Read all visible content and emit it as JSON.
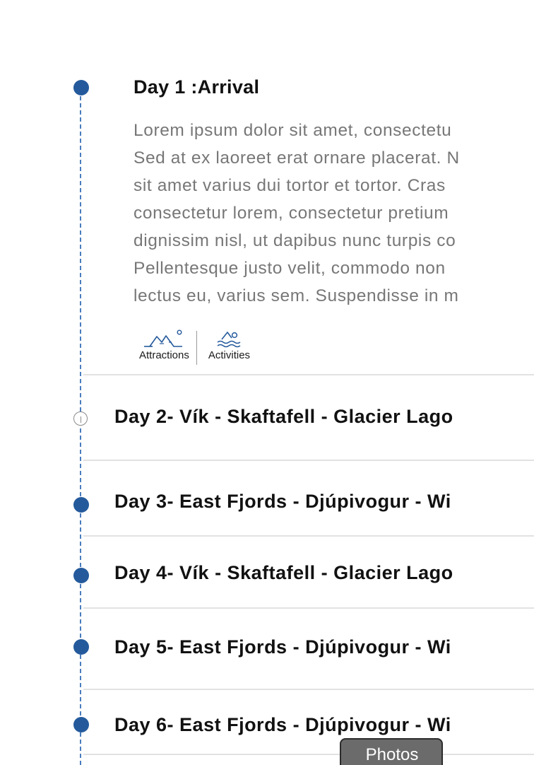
{
  "day1": {
    "title": "Day 1 :Arrival",
    "description_lines": [
      "Lorem ipsum dolor sit amet, consectetu",
      "Sed at ex laoreet erat ornare placerat. N",
      "sit amet varius dui tortor et tortor. Cras",
      "consectetur lorem, consectetur pretium",
      "dignissim nisl, ut dapibus nunc turpis co",
      "Pellentesque justo velit, commodo non",
      "lectus eu, varius sem. Suspendisse in m"
    ],
    "categories": [
      {
        "label": "Attractions",
        "icon": "mountains-icon"
      },
      {
        "label": "Activities",
        "icon": "swimmer-icon"
      }
    ]
  },
  "days": [
    {
      "title": "Day 2- Vík - Skaftafell - Glacier Lago",
      "marker": "info-outline"
    },
    {
      "title": "Day 3- East Fjords - Djúpivogur - Wi",
      "marker": "filled"
    },
    {
      "title": "Day 4- Vík - Skaftafell - Glacier Lago",
      "marker": "filled"
    },
    {
      "title": "Day 5- East Fjords - Djúpivogur - Wi",
      "marker": "filled"
    },
    {
      "title": "Day 6- East Fjords - Djúpivogur - Wi",
      "marker": "filled"
    }
  ],
  "photos_button": {
    "label": "Photos"
  },
  "colors": {
    "accent": "#245a9c",
    "timeline": "#4a7dbd",
    "text": "#111111",
    "muted": "#777777",
    "divider": "#e2e2e2",
    "photos_button_bg": "#6b6b6b"
  }
}
